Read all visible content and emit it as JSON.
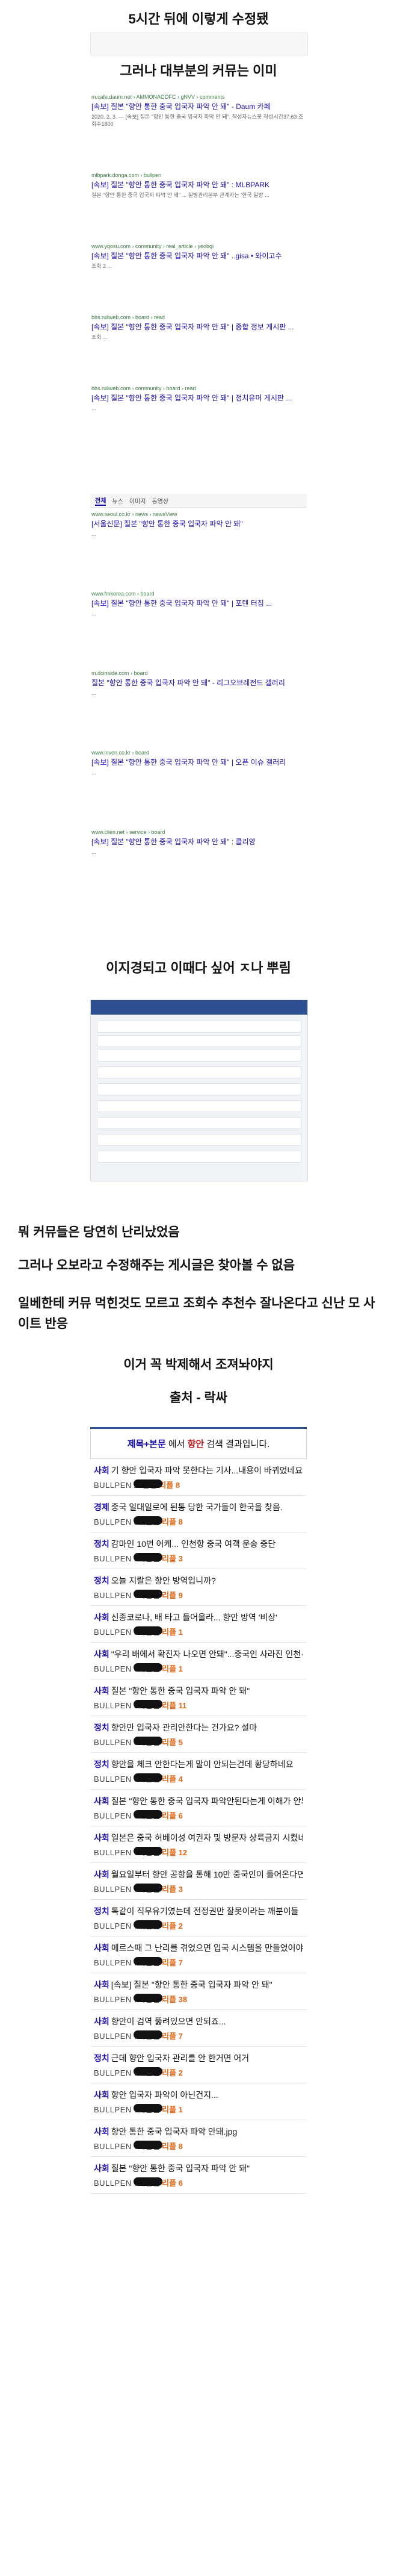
{
  "captions": {
    "c1": "5시간 뒤에 이렇게 수정됐",
    "c2": "그러나 대부분의 커뮤는 이미",
    "c3": "이지경되고 이때다 싶어 ㅈ나 뿌림",
    "c4": "뭐 커뮤들은 당연히 난리났었음",
    "c5": "그러나 오보라고 수정해주는 게시글은 찾아볼 수 없음",
    "c6": "일베한테 커뮤 먹힌것도 모르고 조회수 추천수 잘나온다고 신난 모 사이트 반응",
    "c7": "이거 꼭 박제해서 조져놔야지",
    "c8": "출처 - 락싸"
  },
  "search1": [
    {
      "url": "m.cafe.daum.net › AMMONACOFC › gNVV › comments",
      "title": "[속보] 질본 \"향안 통한 중국 입국자 파악 안 돼\" - Daum 카페",
      "snip": "2020. 2. 3. — [속보] 질본 \"향안 통한 중국 입국자 파악 안 돼\". 작성자뉴스봇 작성시간37.63 조회수1800"
    },
    {
      "url": "mlbpark.donga.com › bullpen",
      "title": "[속보] 질본 \"향안 통한 중국 입국자 파악 안 돼\" : MLBPARK",
      "snip": "질본 \"향안 통한 중국 입국자 파악 안 돼\" ... 질병관리본부 관계자는 '한국 일방 ..."
    },
    {
      "url": "www.ygosu.com › community › real_article › yeobgi",
      "title": "[속보] 질본 \"향안 통한 중국 입국자 파악 안 돼\" ..gisa • 와이고수",
      "snip": "조회 2 ..."
    },
    {
      "url": "bbs.ruliweb.com › board › read",
      "title": "[속보] 질본 \"향안 통한 중국 입국자 파악 안 돼\" | 종합 정보 게시판 ...",
      "snip": "조회 ..."
    },
    {
      "url": "bbs.ruliweb.com › community › board › read",
      "title": "[속보] 질본 \"향안 통한 중국 입국자 파악 안 돼\" | 정치유머 게시판 ...",
      "snip": "..."
    }
  ],
  "search2": [
    {
      "url": "www.seoul.co.kr › news › newsView",
      "title": "[서울신문] 질본 \"향안 통한 중국 입국자 파악 안 돼\"",
      "snip": "..."
    },
    {
      "url": "www.fmkorea.com › board",
      "title": "[속보] 질본 \"향안 통한 중국 입국자 파악 안 돼\" | 포텐 터짐 ...",
      "snip": "..."
    },
    {
      "url": "m.dcinside.com › board",
      "title": "질본 \"향안 통한 중국 입국자 파악 안 돼\" - 리그오브레전드 갤러리",
      "snip": "..."
    },
    {
      "url": "www.inven.co.kr › board",
      "title": "[속보] 질본 \"향안 통한 중국 입국자 파악 안 돼\" | 오픈 이슈 갤러리",
      "snip": "..."
    },
    {
      "url": "www.clien.net › service › board",
      "title": "[속보] 질본 \"향안 통한 중국 입국자 파악 안 돼\" : 클리앙",
      "snip": "..."
    }
  ],
  "board": {
    "query_label": "제목+본문",
    "query_mid": " 에서 ",
    "keyword": "향안",
    "query_tail": " 검색 결과입니다."
  },
  "posts": [
    {
      "cat": "사회",
      "title": "기 향안 입국자 파악 못한다는 기사...내용이 바뀌었네요?",
      "src": "BULLPEN",
      "time": "26분전",
      "rep": "리플 8"
    },
    {
      "cat": "경제",
      "title": "중국 일대일로에 된통 당한 국가들이 한국을 찾음.",
      "src": "BULLPEN",
      "time": "3시간전",
      "rep": "리플 8"
    },
    {
      "cat": "정치",
      "title": "감마인 10번 어케... 인천항 중국 여객 운송 중단",
      "src": "BULLPEN",
      "time": "6시간전",
      "rep": "리플 3"
    },
    {
      "cat": "정치",
      "title": "오늘 지랄은 향안 방역입니까?",
      "src": "BULLPEN",
      "time": "7시간전",
      "rep": "리플 9"
    },
    {
      "cat": "사회",
      "title": "신종코로나, 배 타고 들어올라... 향안 방역 '비상'",
      "src": "BULLPEN",
      "time": "6시간전",
      "rep": "리플 1"
    },
    {
      "cat": "사회",
      "title": "\"우리 배에서 확진자 나오면 안돼\"...중국인 사라진 인천·평택...",
      "src": "BULLPEN",
      "time": "6시간전",
      "rep": "리플 1"
    },
    {
      "cat": "사회",
      "title": "질본 \"향안 통한 중국 입국자 파악 안 돼\"",
      "src": "BULLPEN",
      "time": "6시간전",
      "rep": "리플 11"
    },
    {
      "cat": "정치",
      "title": "향안만 입국자 관리안한다는 건가요? 설마",
      "src": "BULLPEN",
      "time": "6시간전",
      "rep": "리플 5"
    },
    {
      "cat": "정치",
      "title": "향안을 체크 안한다는게 말이 안되는건데 황당하네요",
      "src": "BULLPEN",
      "time": "6시간전",
      "rep": "리플 4"
    },
    {
      "cat": "사회",
      "title": "질본 \"향안 통한 중국 입국자 파악안된다는게 이해가 안되는데",
      "src": "BULLPEN",
      "time": "6시간전",
      "rep": "리플 6"
    },
    {
      "cat": "사회",
      "title": "일본은 중국 허베이성 여권자 및 방문자 상륙금지 시켰네요.",
      "src": "BULLPEN",
      "time": "7시간전",
      "rep": "리플 12"
    },
    {
      "cat": "사회",
      "title": "월요일부터 향안 공항을 통해 10만 중국인이 들어온다면",
      "src": "BULLPEN",
      "time": "7시간전",
      "rep": "리플 3"
    },
    {
      "cat": "정치",
      "title": "톡같이 직무유기였는데 전정권만 잘못이라는 깨분이들",
      "src": "BULLPEN",
      "time": "7시간전",
      "rep": "리플 2"
    },
    {
      "cat": "사회",
      "title": "메르스때 그 난리를 겪었으면 입국 시스템을 만들었어야지...",
      "src": "BULLPEN",
      "time": "7시간전",
      "rep": "리플 7"
    },
    {
      "cat": "사회",
      "title": "[속보] 질본 \"향안 통한 중국 입국자 파악 안 돼\"",
      "src": "BULLPEN",
      "time": "7시간전",
      "rep": "리플 38"
    },
    {
      "cat": "사회",
      "title": "향안이 검역 뚫려있으면 안되죠...",
      "src": "BULLPEN",
      "time": "7시간전",
      "rep": "리플 7"
    },
    {
      "cat": "정치",
      "title": "근데 향안 입국자 관리를 안 한거면 어거",
      "src": "BULLPEN",
      "time": "7시간전",
      "rep": "리플 2"
    },
    {
      "cat": "사회",
      "title": "향안 입국자 파악이 아닌건지...",
      "src": "BULLPEN",
      "time": "7시간전",
      "rep": "리플 1"
    },
    {
      "cat": "사회",
      "title": "향안 통한 중국 입국자 파악 안돼.jpg",
      "src": "BULLPEN",
      "time": "7시간전",
      "rep": "리플 8"
    },
    {
      "cat": "사회",
      "title": "질본 \"향안 통한 중국 입국자 파악 안 돼\"",
      "src": "BULLPEN",
      "time": "7시간전",
      "rep": "리플 6"
    }
  ]
}
